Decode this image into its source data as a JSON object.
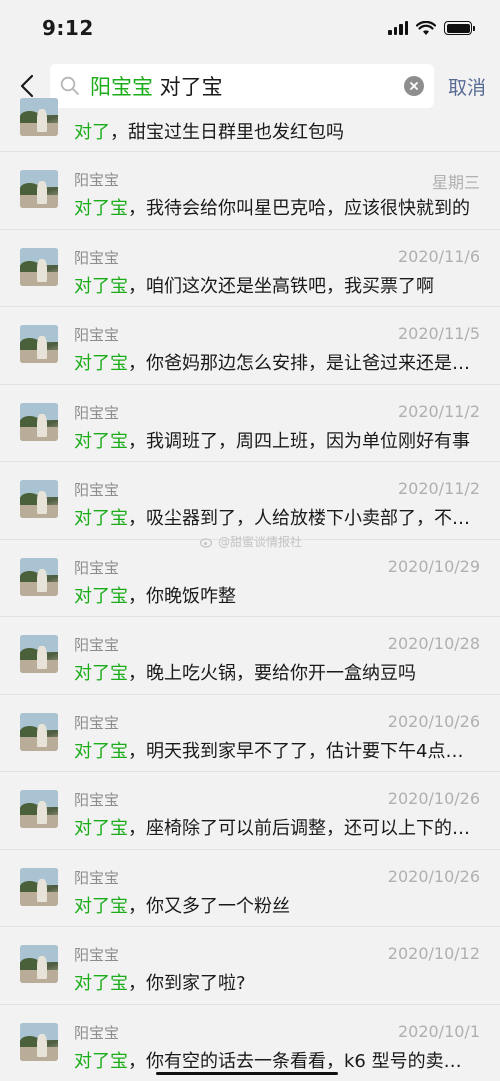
{
  "status": {
    "time": "9:12"
  },
  "search": {
    "query_highlight": "阳宝宝",
    "query_rest": " 对了宝",
    "cancel_label": "取消"
  },
  "partial_result": {
    "hl": "对了",
    "msg": "，甜宝过生日群里也发红包吗"
  },
  "results": [
    {
      "name": "阳宝宝",
      "date": "星期三",
      "hl": "对了宝",
      "msg": "，我待会给你叫星巴克哈，应该很快就到的"
    },
    {
      "name": "阳宝宝",
      "date": "2020/11/6",
      "hl": "对了宝",
      "msg": "，咱们这次还是坐高铁吧，我买票了啊"
    },
    {
      "name": "阳宝宝",
      "date": "2020/11/5",
      "hl": "对了宝",
      "msg": "，你爸妈那边怎么安排，是让爸过来还是…"
    },
    {
      "name": "阳宝宝",
      "date": "2020/11/2",
      "hl": "对了宝",
      "msg": "，我调班了，周四上班，因为单位刚好有事"
    },
    {
      "name": "阳宝宝",
      "date": "2020/11/2",
      "hl": "对了宝",
      "msg": "，吸尘器到了，人给放楼下小卖部了，不…"
    },
    {
      "name": "阳宝宝",
      "date": "2020/10/29",
      "hl": "对了宝",
      "msg": "，你晚饭咋整"
    },
    {
      "name": "阳宝宝",
      "date": "2020/10/28",
      "hl": "对了宝",
      "msg": "，晚上吃火锅，要给你开一盒纳豆吗"
    },
    {
      "name": "阳宝宝",
      "date": "2020/10/26",
      "hl": "对了宝",
      "msg": "，明天我到家早不了了，估计要下午4点…"
    },
    {
      "name": "阳宝宝",
      "date": "2020/10/26",
      "hl": "对了宝",
      "msg": "，座椅除了可以前后调整，还可以上下的…"
    },
    {
      "name": "阳宝宝",
      "date": "2020/10/26",
      "hl": "对了宝",
      "msg": "，你又多了一个粉丝"
    },
    {
      "name": "阳宝宝",
      "date": "2020/10/12",
      "hl": "对了宝",
      "msg": "，你到家了啦?"
    },
    {
      "name": "阳宝宝",
      "date": "2020/10/1",
      "hl": "对了宝",
      "msg": "，你有空的话去一条看看，k6 型号的卖…"
    }
  ],
  "watermark": {
    "text": "@甜蜜谈情报社"
  }
}
